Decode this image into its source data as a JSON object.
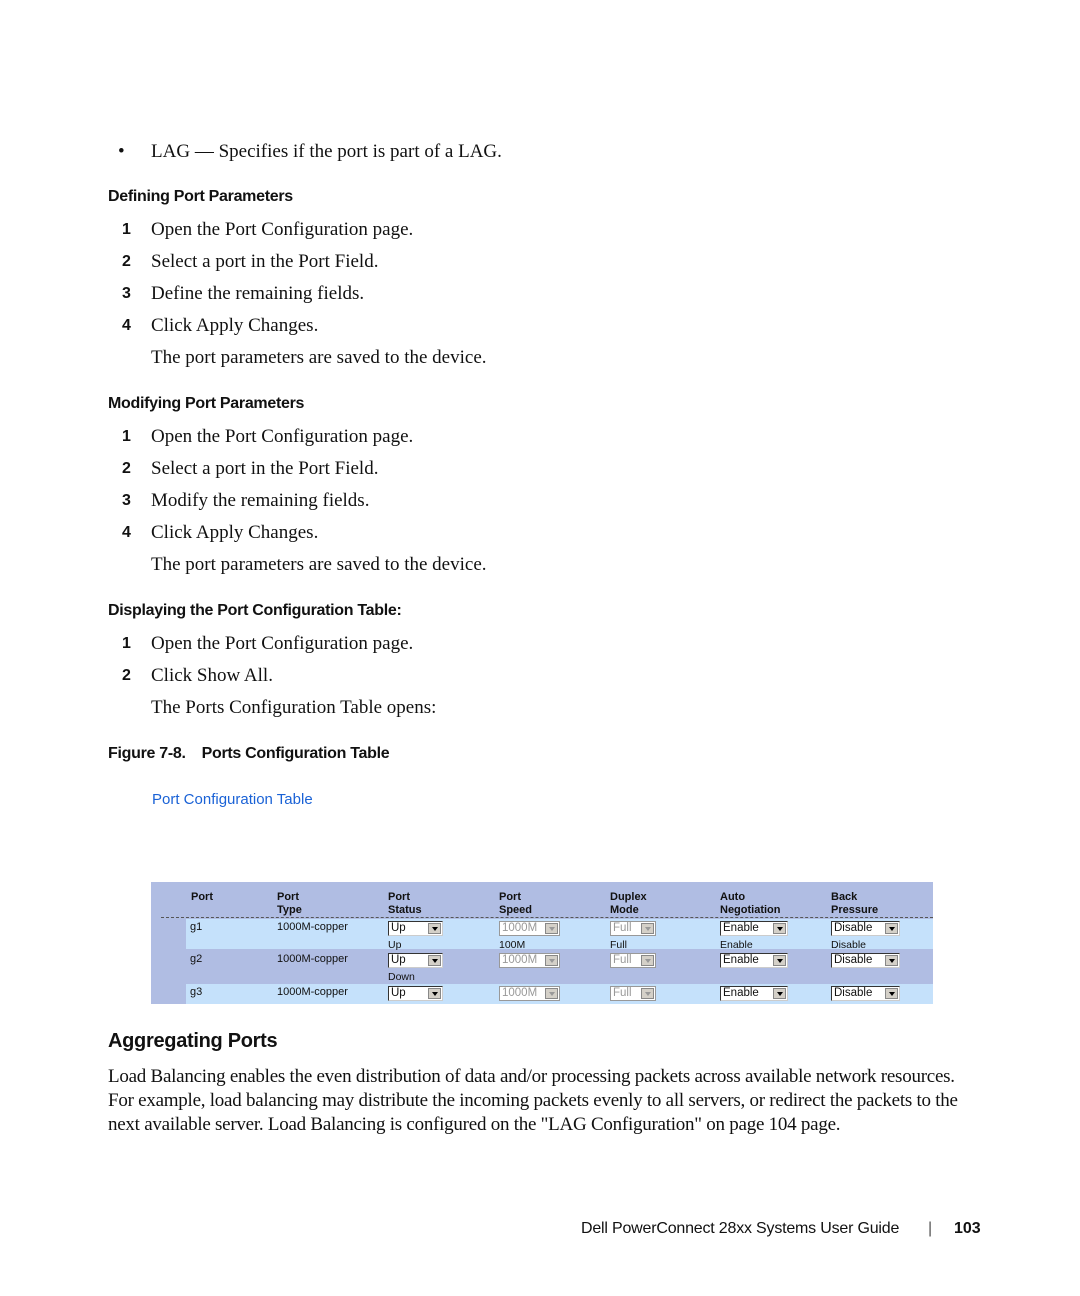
{
  "bullet": {
    "term": "LAG",
    "text": " — Specifies if the port is part of a LAG."
  },
  "sections": {
    "defining": {
      "heading": "Defining Port Parameters",
      "steps": [
        {
          "num": "1",
          "pre": "Open the ",
          "emph": "Port Configuration",
          "post": " page."
        },
        {
          "num": "2",
          "pre": "Select a port in the ",
          "emph": "Port",
          "post": " Field."
        },
        {
          "num": "3",
          "pre": "Define the remaining fields.",
          "emph": "",
          "post": ""
        },
        {
          "num": "4",
          "pre": "Click ",
          "emph": "Apply Changes",
          "post": "."
        }
      ],
      "note": "The port parameters are saved to the device."
    },
    "modifying": {
      "heading": "Modifying Port Parameters",
      "steps": [
        {
          "num": "1",
          "pre": "Open the ",
          "emph": "Port Configuration",
          "post": " page."
        },
        {
          "num": "2",
          "pre": "Select a port in the ",
          "emph": "Port",
          "post": " Field."
        },
        {
          "num": "3",
          "pre": "Modify the remaining fields.",
          "emph": "",
          "post": ""
        },
        {
          "num": "4",
          "pre": "Click ",
          "emph": "Apply Changes",
          "post": "."
        }
      ],
      "note": "The port parameters are saved to the device."
    },
    "displaying": {
      "heading": "Displaying the Port Configuration Table:",
      "steps": [
        {
          "num": "1",
          "pre": "Open the ",
          "emph": "Port Configuration",
          "post": " page."
        },
        {
          "num": "2",
          "pre": "Click ",
          "emph": "Show All",
          "post": "."
        }
      ],
      "note_pre": "The ",
      "note_emph": "Ports Configuration Table",
      "note_post": " opens:"
    }
  },
  "figure": {
    "caption_label": "Figure 7-8.",
    "caption_title": "Ports Configuration Table",
    "screenshot_title": "Port Configuration Table",
    "title_color": "#1a62d6",
    "table_bg": "#b0bde3",
    "row_highlight": "#c5e1fb",
    "headers": [
      {
        "l1": "Port",
        "l2": ""
      },
      {
        "l1": "Port",
        "l2": "Type"
      },
      {
        "l1": "Port",
        "l2": "Status"
      },
      {
        "l1": "Port",
        "l2": "Speed"
      },
      {
        "l1": "Duplex",
        "l2": "Mode"
      },
      {
        "l1": "Auto",
        "l2": "Negotiation"
      },
      {
        "l1": "Back",
        "l2": "Pressure"
      }
    ],
    "rows": [
      {
        "port": "g1",
        "type": "1000M-copper",
        "status": "Up",
        "speed": "1000M",
        "duplex": "Full",
        "auto": "Enable",
        "back": "Disable",
        "sub_status": "Up",
        "sub_speed": "100M",
        "sub_duplex": "Full",
        "sub_auto": "Enable",
        "sub_back": "Disable"
      },
      {
        "port": "g2",
        "type": "1000M-copper",
        "status": "Up",
        "speed": "1000M",
        "duplex": "Full",
        "auto": "Enable",
        "back": "Disable",
        "sub_status": "Down",
        "sub_speed": "",
        "sub_duplex": "",
        "sub_auto": "",
        "sub_back": ""
      },
      {
        "port": "g3",
        "type": "1000M-copper",
        "status": "Up",
        "speed": "1000M",
        "duplex": "Full",
        "auto": "Enable",
        "back": "Disable",
        "sub_status": "",
        "sub_speed": "",
        "sub_duplex": "",
        "sub_auto": "",
        "sub_back": ""
      }
    ]
  },
  "aggregating": {
    "heading": "Aggregating Ports",
    "paragraph": "Load Balancing enables the even distribution of data and/or processing packets across available network resources. For example, load balancing may distribute the incoming packets evenly to all servers, or redirect the packets to the next available server. Load Balancing is configured on the \"LAG Configuration\" on page 104 page."
  },
  "footer": {
    "guide_title": "Dell PowerConnect 28xx Systems User Guide",
    "separator": "|",
    "page_number": "103"
  }
}
